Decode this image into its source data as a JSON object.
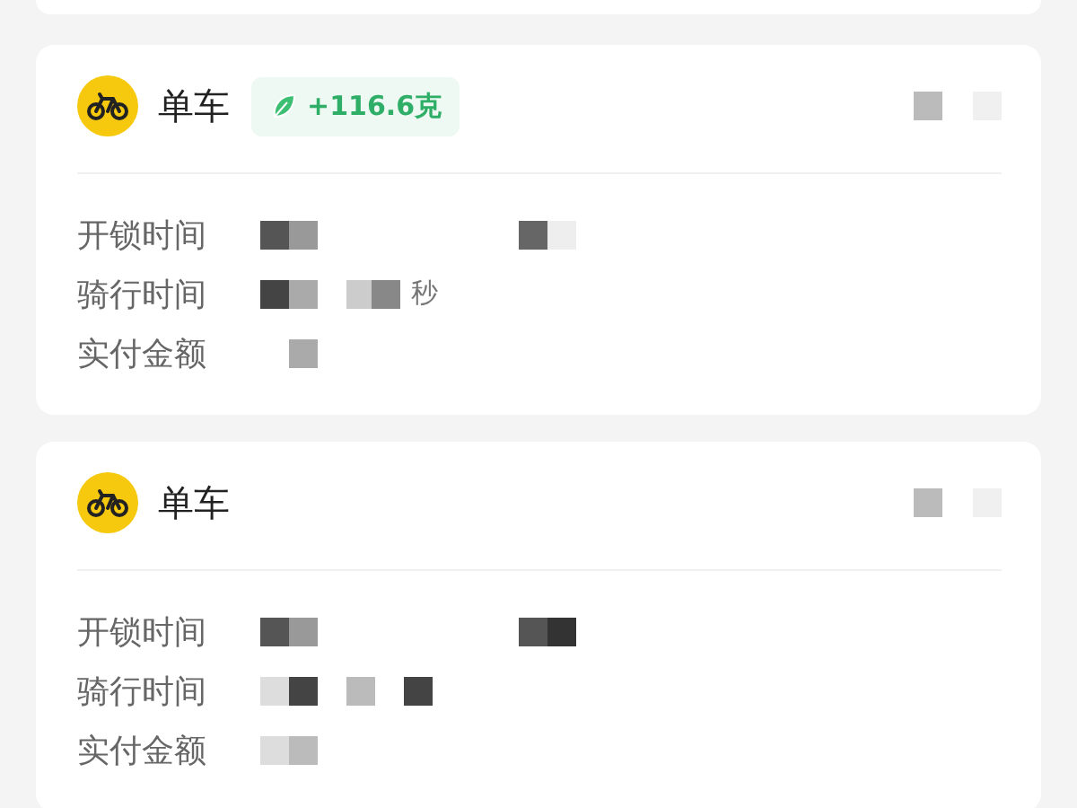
{
  "trips": [
    {
      "title": "单车",
      "carbon_badge": "+116.6克",
      "rows": [
        {
          "label": "开锁时间",
          "redacted": true
        },
        {
          "label": "骑行时间",
          "redacted": true,
          "value": "秒"
        },
        {
          "label": "实付金额",
          "redacted": true
        }
      ]
    },
    {
      "title": "单车",
      "rows": [
        {
          "label": "开锁时间",
          "redacted": true
        },
        {
          "label": "骑行时间",
          "redacted": true
        },
        {
          "label": "实付金额",
          "redacted": true
        }
      ]
    }
  ]
}
